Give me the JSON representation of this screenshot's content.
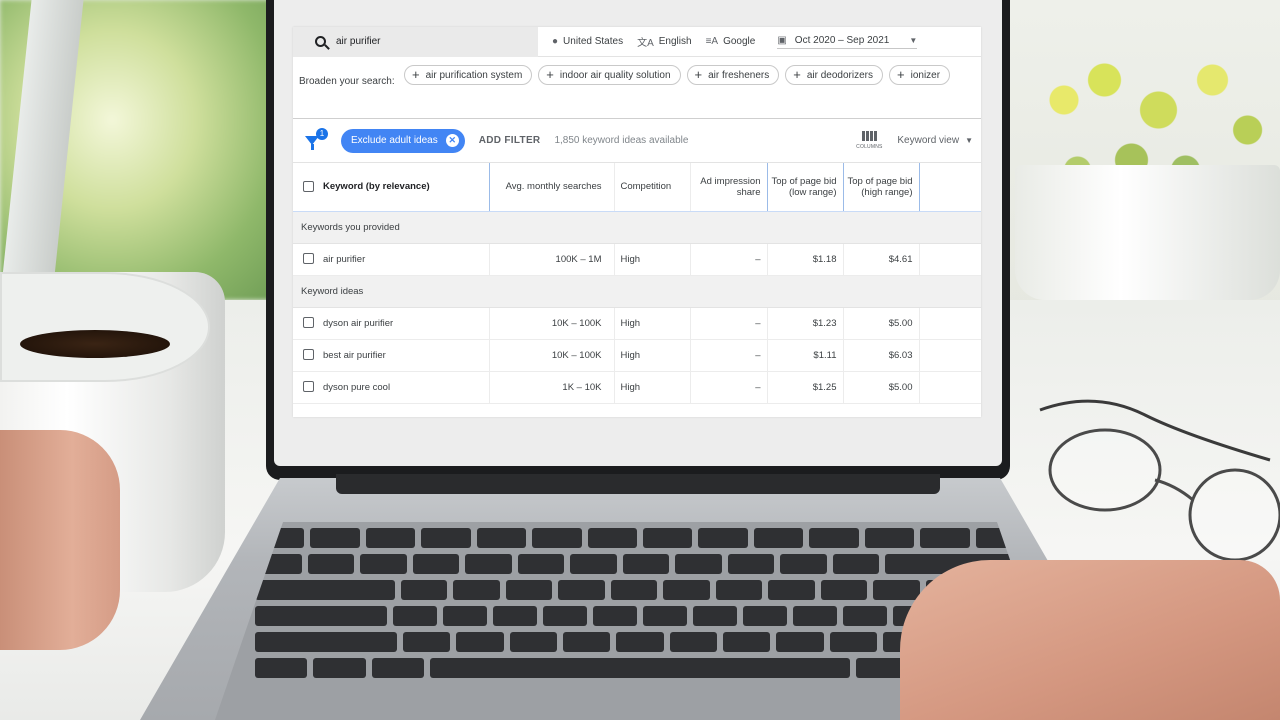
{
  "search": {
    "query": "air purifier"
  },
  "targeting": {
    "location": "United States",
    "language": "English",
    "network": "Google",
    "date_range": "Oct 2020 – Sep 2021"
  },
  "broaden": {
    "label": "Broaden your search:",
    "chips": [
      "air purification system",
      "indoor air quality solution",
      "air fresheners",
      "air deodorizers",
      "ionizer"
    ]
  },
  "filters": {
    "badge_count": "1",
    "active_filter": "Exclude adult ideas",
    "add_filter_label": "ADD FILTER",
    "ideas_available": "1,850 keyword ideas available",
    "columns_label": "COLUMNS",
    "view_label": "Keyword view"
  },
  "table": {
    "headers": {
      "keyword": "Keyword (by relevance)",
      "avg_searches": "Avg. monthly searches",
      "competition": "Competition",
      "impression_share": "Ad impression share",
      "bid_low": "Top of page bid (low range)",
      "bid_high": "Top of page bid (high range)"
    },
    "group_provided": "Keywords you provided",
    "provided": [
      {
        "keyword": "air purifier",
        "avg": "100K – 1M",
        "competition": "High",
        "impression": "–",
        "low": "$1.18",
        "high": "$4.61"
      }
    ],
    "group_ideas": "Keyword ideas",
    "ideas": [
      {
        "keyword": "dyson air purifier",
        "avg": "10K – 100K",
        "competition": "High",
        "impression": "–",
        "low": "$1.23",
        "high": "$5.00"
      },
      {
        "keyword": "best air purifier",
        "avg": "10K – 100K",
        "competition": "High",
        "impression": "–",
        "low": "$1.11",
        "high": "$6.03"
      },
      {
        "keyword": "dyson pure cool",
        "avg": "1K – 10K",
        "competition": "High",
        "impression": "–",
        "low": "$1.25",
        "high": "$5.00"
      }
    ]
  },
  "colors": {
    "accent": "#4285f4",
    "filter_icon": "#1a73e8"
  }
}
